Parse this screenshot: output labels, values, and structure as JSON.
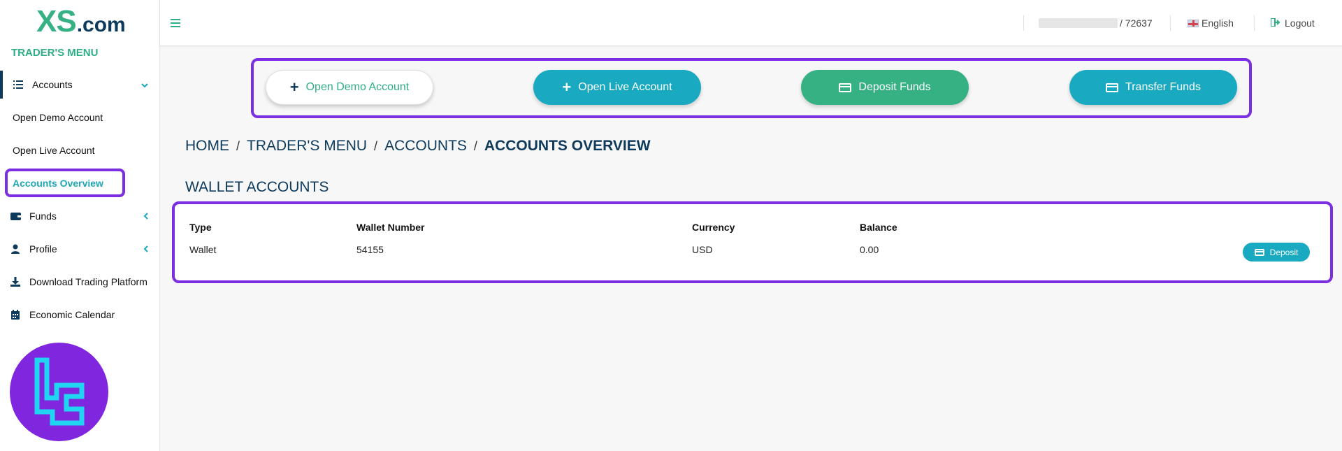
{
  "brand": {
    "logo_primary": "XS",
    "logo_secondary": ".com",
    "primary_color": "#35b184",
    "secondary_color": "#0e3a5c"
  },
  "sidebar": {
    "title": "TRADER'S MENU",
    "items": [
      {
        "label": "Accounts",
        "icon": "list-icon",
        "chevron": "chevron-down-icon"
      },
      {
        "label": "Funds",
        "icon": "wallet-icon",
        "chevron": "chevron-left-icon"
      },
      {
        "label": "Profile",
        "icon": "user-icon",
        "chevron": "chevron-left-icon"
      },
      {
        "label": "Download Trading Platform",
        "icon": "download-icon"
      },
      {
        "label": "Economic Calendar",
        "icon": "calendar-icon"
      }
    ],
    "accounts_submenu": [
      {
        "label": "Open Demo Account"
      },
      {
        "label": "Open Live Account"
      },
      {
        "label": "Accounts Overview",
        "active": true
      }
    ]
  },
  "topbar": {
    "account_number": "/ 72637",
    "language": "English",
    "logout": "Logout"
  },
  "actions": {
    "open_demo": "Open Demo Account",
    "open_live": "Open Live Account",
    "deposit_funds": "Deposit Funds",
    "transfer_funds": "Transfer Funds"
  },
  "breadcrumb": {
    "items": [
      "HOME",
      "TRADER'S MENU",
      "ACCOUNTS"
    ],
    "separator": "/",
    "current": "ACCOUNTS OVERVIEW"
  },
  "wallet_section": {
    "title": "WALLET ACCOUNTS",
    "columns": [
      "Type",
      "Wallet Number",
      "Currency",
      "Balance"
    ],
    "rows": [
      {
        "type": "Wallet",
        "wallet_number": "54155",
        "currency": "USD",
        "balance": "0.00",
        "action": "Deposit"
      }
    ]
  },
  "colors": {
    "highlight": "#7b2fe0",
    "teal": "#19aac1",
    "green": "#35b184",
    "badge": "#8126df"
  }
}
